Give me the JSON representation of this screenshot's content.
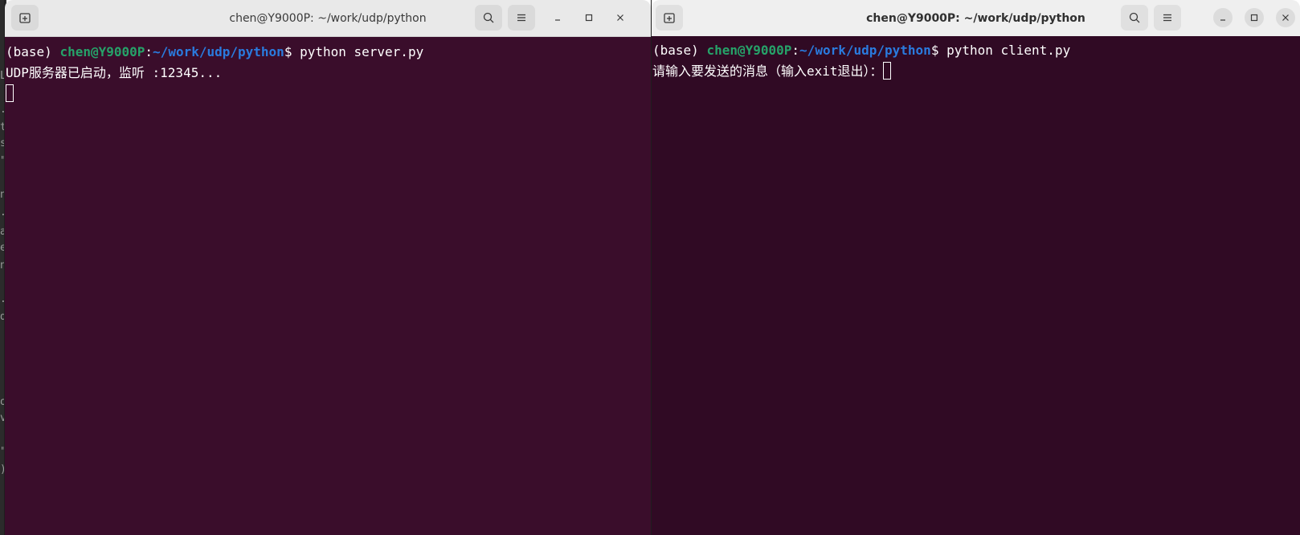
{
  "left_terminal": {
    "title": "chen@Y9000P: ~/work/udp/python",
    "prompt_env": "(base) ",
    "prompt_user": "chen@Y9000P",
    "prompt_sep": ":",
    "prompt_path": "~/work/udp/python",
    "prompt_symbol": "$ ",
    "command": "python server.py",
    "output_line": "UDP服务器已启动，监听 :12345..."
  },
  "right_terminal": {
    "title": "chen@Y9000P: ~/work/udp/python",
    "prompt_env": "(base) ",
    "prompt_user": "chen@Y9000P",
    "prompt_sep": ":",
    "prompt_path": "~/work/udp/python",
    "prompt_symbol": "$ ",
    "command": "python client.py",
    "input_prompt": "请输入要发送的消息（输入exit退出）："
  },
  "background_fragments": [
    "L",
    ".",
    "t",
    "s",
    "\"",
    "n",
    ".",
    "a",
    "e",
    "n",
    ".",
    "d",
    "o",
    "v",
    "\"",
    ")"
  ],
  "icons": {
    "new_tab": "new-tab-icon",
    "search": "search-icon",
    "menu": "hamburger-menu-icon",
    "minimize": "minimize-icon",
    "maximize": "maximize-icon",
    "close": "close-icon"
  },
  "colors": {
    "terminal_bg_left": "#3a0d2b",
    "terminal_bg_right": "#300a24",
    "prompt_user": "#26a269",
    "prompt_path": "#2a7bde",
    "text": "#ffffff"
  }
}
